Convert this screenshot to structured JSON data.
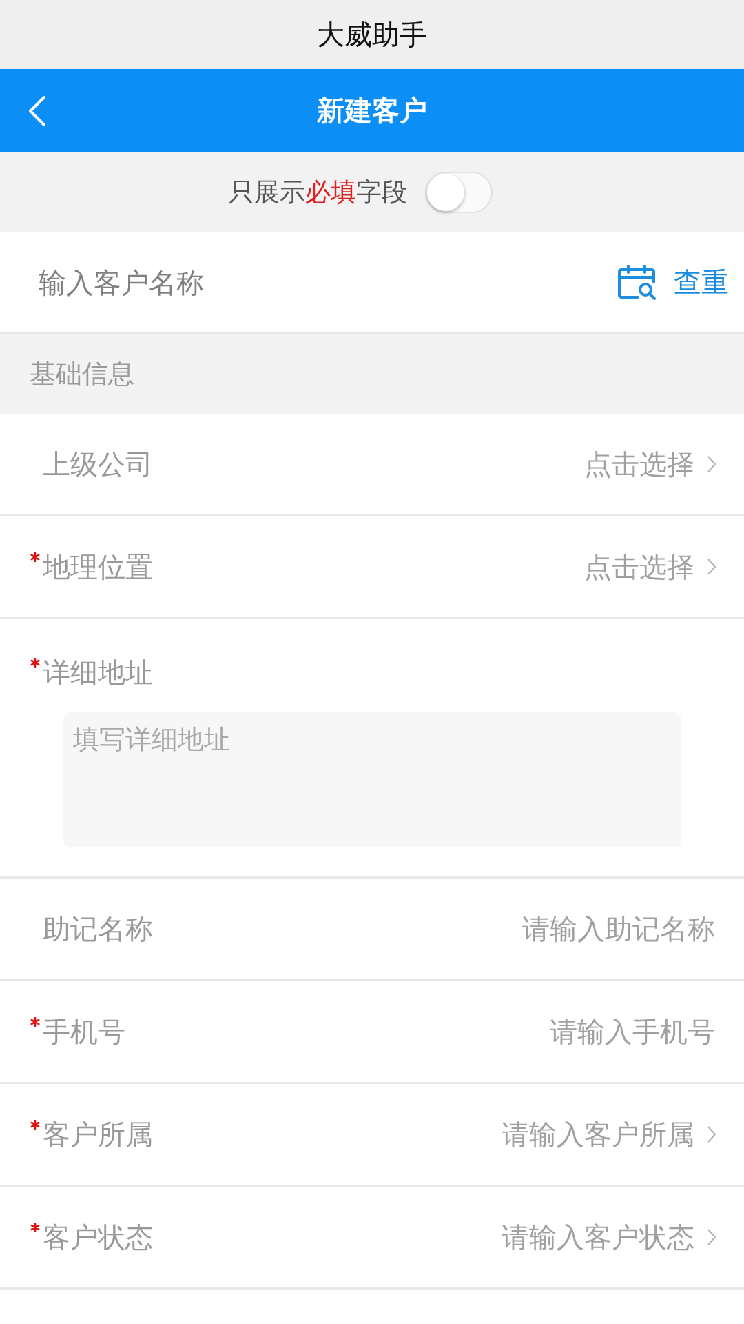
{
  "app_title": "大威助手",
  "header": {
    "title": "新建客户"
  },
  "filter": {
    "label_parts": [
      {
        "text": "只展示",
        "highlight": false
      },
      {
        "text": "必填",
        "highlight": true
      },
      {
        "text": "字段",
        "highlight": false
      }
    ],
    "on": false
  },
  "name_field": {
    "placeholder": "输入客户名称",
    "action": "查重"
  },
  "section": {
    "title": "基础信息"
  },
  "fields": [
    {
      "kind": "select",
      "label": "上级公司",
      "required": false,
      "placeholder": "点击选择"
    },
    {
      "kind": "select",
      "label": "地理位置",
      "required": true,
      "placeholder": "点击选择"
    },
    {
      "kind": "textarea",
      "label": "详细地址",
      "required": true,
      "placeholder": "填写详细地址"
    },
    {
      "kind": "input",
      "label": "助记名称",
      "required": false,
      "placeholder": "请输入助记名称"
    },
    {
      "kind": "input",
      "label": "手机号",
      "required": true,
      "placeholder": "请输入手机号"
    },
    {
      "kind": "select",
      "label": "客户所属",
      "required": true,
      "placeholder": "请输入客户所属"
    },
    {
      "kind": "select",
      "label": "客户状态",
      "required": true,
      "placeholder": "请输入客户状态"
    }
  ]
}
